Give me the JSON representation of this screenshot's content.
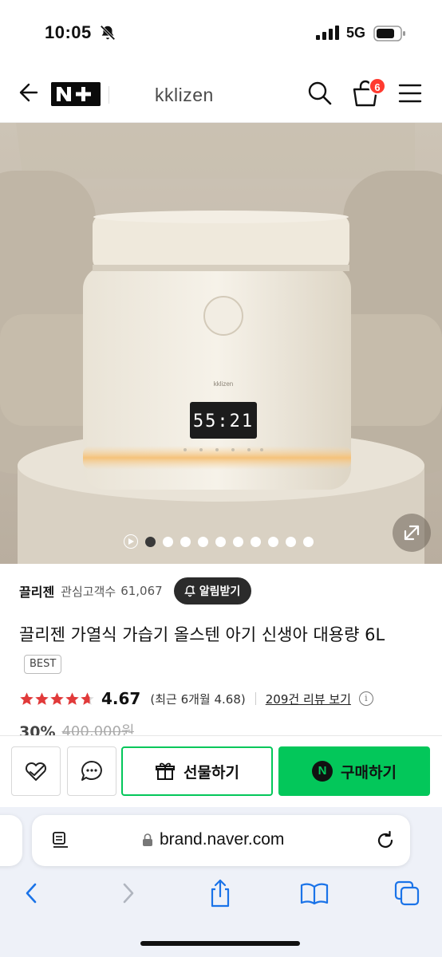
{
  "status_bar": {
    "time": "10:05",
    "network": "5G"
  },
  "nav": {
    "brand": "kklizen",
    "cart_count": "6"
  },
  "product": {
    "image_alt": "kklizen",
    "carousel": {
      "total_slides": 10,
      "active_index": 0
    },
    "store_name": "끌리젠",
    "follower_label": "관심고객수",
    "follower_count": "61,067",
    "alarm_button": "알림받기",
    "title": "끌리젠 가열식 가습기 올스텐 아기 신생아 대용량 6L",
    "tag": "BEST",
    "rating": {
      "stars_fraction": 0.934,
      "value": "4.67",
      "recent": "(최근 6개월 4.68)",
      "review_link": "209건 리뷰 보기"
    },
    "price": {
      "discount": "30%",
      "original": "400,000원"
    }
  },
  "actions": {
    "gift_label": "선물하기",
    "buy_label": "구매하기",
    "buy_logo": "N"
  },
  "safari": {
    "url": "brand.naver.com"
  },
  "colors": {
    "naver_green": "#03c75a",
    "star_red": "#e13a3a",
    "badge_red": "#ff3b30",
    "safari_blue": "#1a73e8"
  },
  "icons": [
    "bell-off-icon",
    "signal-icon",
    "battery-icon",
    "back-arrow-icon",
    "search-icon",
    "cart-icon",
    "menu-icon",
    "expand-icon",
    "play-icon",
    "bell-plus-icon",
    "star-icon",
    "info-icon",
    "heart-check-icon",
    "chat-icon",
    "gift-icon",
    "reader-icon",
    "lock-icon",
    "reload-icon",
    "chevron-left-icon",
    "chevron-right-icon",
    "share-icon",
    "bookmarks-icon",
    "tabs-icon"
  ]
}
